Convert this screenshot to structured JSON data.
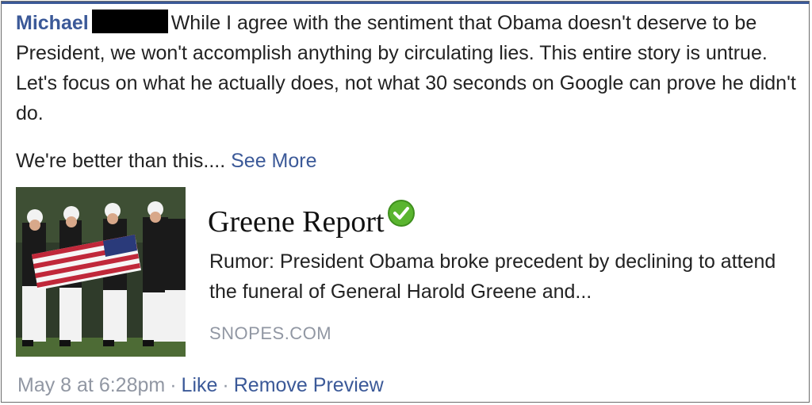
{
  "comment": {
    "author": "Michael",
    "text": "While I agree with the sentiment that Obama doesn't deserve to be President, we won't accomplish anything by circulating lies. This entire story is untrue. Let's focus on what he actually does, not what 30 seconds on Google can prove he didn't do.",
    "text2": "We're better than this....",
    "see_more": "See More"
  },
  "preview": {
    "title": "Greene Report",
    "verified_icon": "green-check-icon",
    "description": "Rumor: President Obama broke precedent by declining to attend the funeral of General Harold Greene and...",
    "source": "SNOPES.COM",
    "thumbnail_icon": "funeral-flag-casket-photo"
  },
  "meta": {
    "timestamp": "May 8 at 6:28pm",
    "separator": "·",
    "like": "Like",
    "remove_preview": "Remove Preview"
  },
  "colors": {
    "link": "#3b5998",
    "meta_gray": "#9197a3",
    "check_green": "#5ab52f"
  }
}
